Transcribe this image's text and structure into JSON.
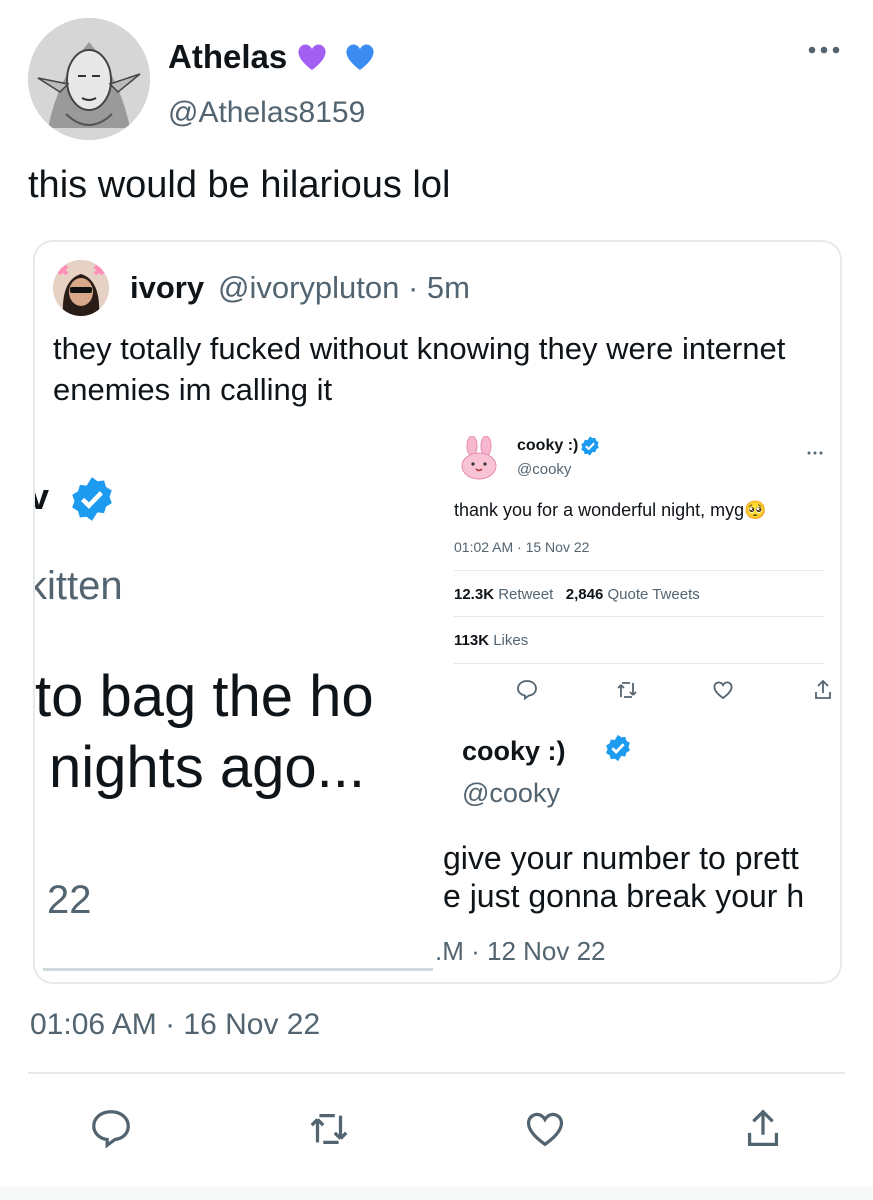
{
  "tweet": {
    "display_name": "Athelas",
    "handle": "@Athelas8159",
    "text": "this would be hilarious lol",
    "timestamp": "01:06 AM · 16 Nov 22"
  },
  "quote": {
    "name": "ivory",
    "handle_time": "@ivorypluton · 5m",
    "text": "they totally fucked without knowing they were internet enemies im calling it"
  },
  "left_fragment": {
    "name_partial": "v",
    "handle_partial": "kitten",
    "line1": "to bag the ho",
    "line2": "nights ago...",
    "date_partial": "22"
  },
  "cooky_tweet": {
    "name": "cooky :)",
    "handle": "@cooky",
    "text": "thank you for a wonderful night, myg🥺",
    "time": "01:02 AM · 15 Nov 22",
    "retweets_value": "12.3K",
    "retweets_label": "Retweet",
    "quotes_value": "2,846",
    "quotes_label": "Quote Tweets",
    "likes_value": "113K",
    "likes_label": "Likes"
  },
  "cooky_tweet2": {
    "name": "cooky :)",
    "handle": "@cooky",
    "line1": "give your number to prett",
    "line2": "e just gonna break your h",
    "time": ".M · 12 Nov 22"
  },
  "icons": [
    "purple-heart-icon",
    "blue-heart-icon",
    "more-icon",
    "verified-badge-icon",
    "reply-icon",
    "retweet-icon",
    "like-icon",
    "share-icon"
  ],
  "colors": {
    "verified": "#1d9bf0",
    "secondary_text": "#536471",
    "purple_heart": "#a35ef2",
    "blue_heart": "#3b8cf0"
  }
}
